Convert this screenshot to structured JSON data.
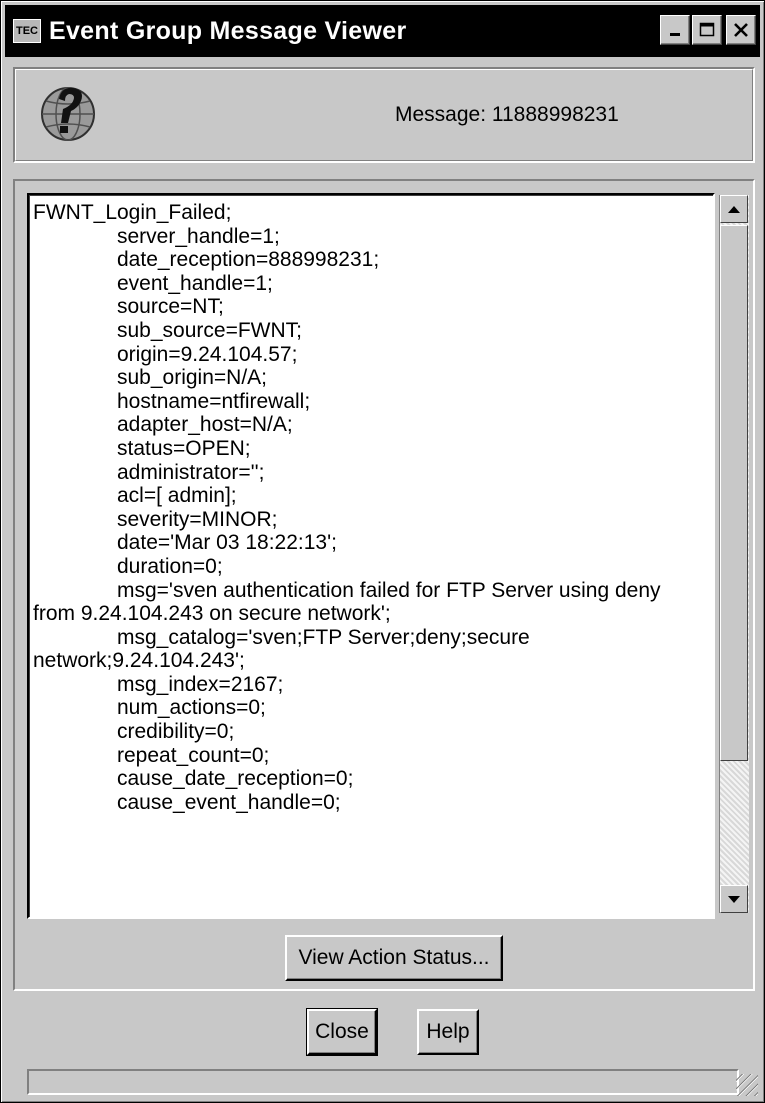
{
  "window": {
    "title": "Event Group Message Viewer",
    "app_icon": "tec-app-icon",
    "controls": {
      "minimize": "_",
      "maximize": "□",
      "close": "×"
    }
  },
  "header": {
    "icon": "help-globe-icon",
    "message_label": "Message: 11888998231"
  },
  "message": {
    "lines": [
      {
        "text": "FWNT_Login_Failed;",
        "indent": false
      },
      {
        "text": "server_handle=1;",
        "indent": true
      },
      {
        "text": "date_reception=888998231;",
        "indent": true
      },
      {
        "text": "event_handle=1;",
        "indent": true
      },
      {
        "text": "source=NT;",
        "indent": true
      },
      {
        "text": "sub_source=FWNT;",
        "indent": true
      },
      {
        "text": "origin=9.24.104.57;",
        "indent": true
      },
      {
        "text": "sub_origin=N/A;",
        "indent": true
      },
      {
        "text": "hostname=ntfirewall;",
        "indent": true
      },
      {
        "text": "adapter_host=N/A;",
        "indent": true
      },
      {
        "text": "status=OPEN;",
        "indent": true
      },
      {
        "text": "administrator='';",
        "indent": true
      },
      {
        "text": "acl=[ admin];",
        "indent": true
      },
      {
        "text": "severity=MINOR;",
        "indent": true
      },
      {
        "text": "date='Mar 03 18:22:13';",
        "indent": true
      },
      {
        "text": "duration=0;",
        "indent": true
      },
      {
        "text": "msg='sven authentication failed for FTP Server using deny",
        "indent": true
      },
      {
        "text": "from 9.24.104.243 on secure network';",
        "indent": false
      },
      {
        "text": "msg_catalog='sven;FTP Server;deny;secure",
        "indent": true
      },
      {
        "text": "network;9.24.104.243';",
        "indent": false
      },
      {
        "text": "msg_index=2167;",
        "indent": true
      },
      {
        "text": "num_actions=0;",
        "indent": true
      },
      {
        "text": "credibility=0;",
        "indent": true
      },
      {
        "text": "repeat_count=0;",
        "indent": true
      },
      {
        "text": "cause_date_reception=0;",
        "indent": true
      },
      {
        "text": "cause_event_handle=0;",
        "indent": true
      }
    ]
  },
  "buttons": {
    "view_action_status": "View Action Status...",
    "close": "Close",
    "help": "Help"
  },
  "colors": {
    "window_bg": "#c8c8c8",
    "titlebar_bg": "#000000",
    "titlebar_text": "#ffffff",
    "text_bg": "#ffffff"
  }
}
